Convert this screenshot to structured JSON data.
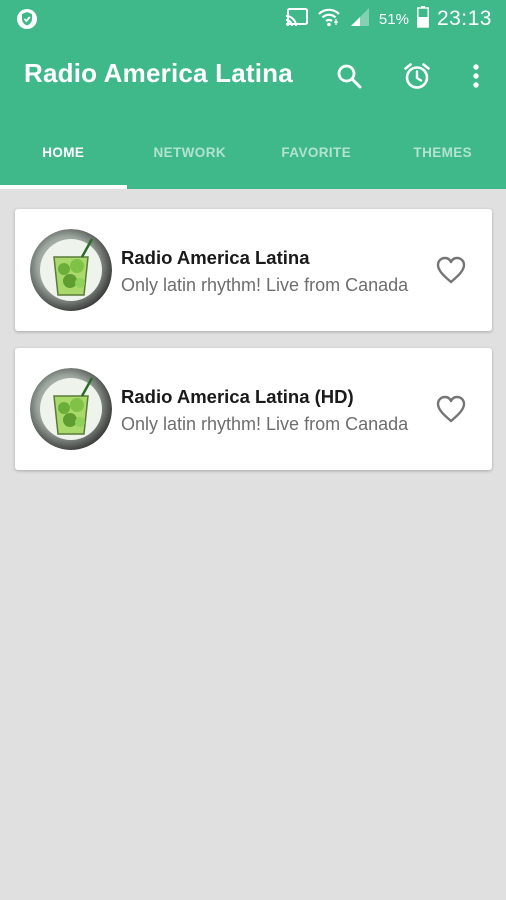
{
  "status_bar": {
    "battery_text": "51%",
    "time": "23:13",
    "icons": [
      "shield-icon",
      "cast-icon",
      "wifi-icon",
      "signal-icon",
      "battery-icon"
    ]
  },
  "toolbar": {
    "title": "Radio America Latina",
    "actions": [
      "search-icon",
      "alarm-icon",
      "more-vert-icon"
    ]
  },
  "tabs": [
    {
      "label": "HOME",
      "active": true
    },
    {
      "label": "NETWORK",
      "active": false
    },
    {
      "label": "FAVORITE",
      "active": false
    },
    {
      "label": "THEMES",
      "active": false
    }
  ],
  "stations": [
    {
      "name": "Radio America Latina",
      "description": "Only latin rhythm! Live from Canada",
      "favorite": false
    },
    {
      "name": "Radio America Latina (HD)",
      "description": "Only latin rhythm! Live from Canada",
      "favorite": false
    }
  ],
  "colors": {
    "primary": "#3fb98a",
    "background": "#e0e0e0",
    "card": "#ffffff",
    "title_text": "#1a1a1a",
    "subtitle_text": "#6e6e6e",
    "icon_gray": "#757575"
  }
}
